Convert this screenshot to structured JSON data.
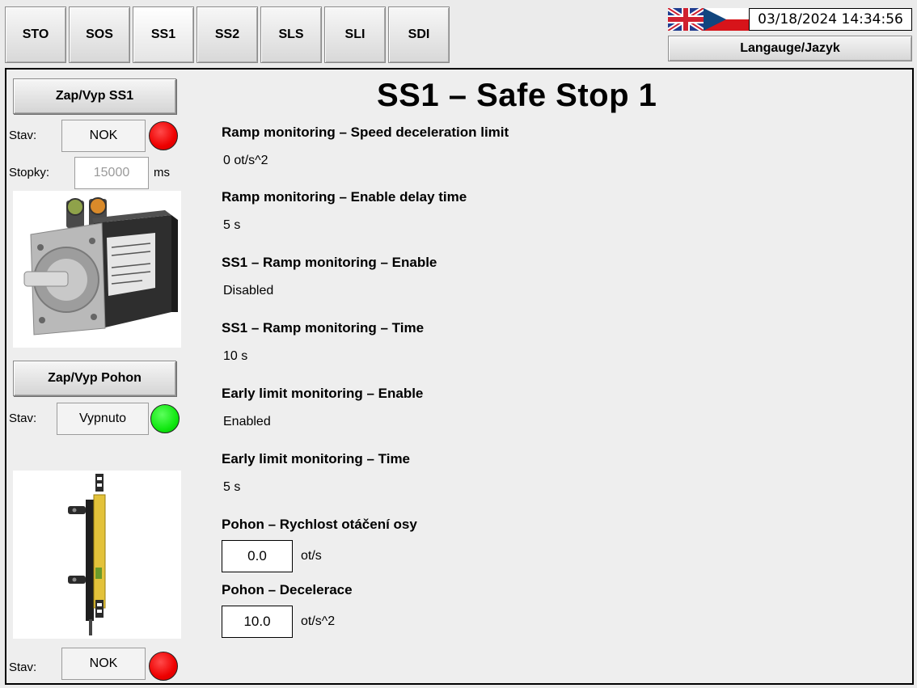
{
  "tabs": [
    {
      "label": "STO"
    },
    {
      "label": "SOS"
    },
    {
      "label": "SS1"
    },
    {
      "label": "SS2"
    },
    {
      "label": "SLS"
    },
    {
      "label": "SLI"
    },
    {
      "label": "SDI"
    }
  ],
  "active_tab": "SS1",
  "header": {
    "datetime": "03/18/2024 14:34:56",
    "language_button": "Langauge/Jazyk",
    "flags": [
      "uk-flag-icon",
      "czech-flag-icon"
    ]
  },
  "left_panel": {
    "ss1_toggle_label": "Zap/Vyp SS1",
    "ss1_state_label": "Stav:",
    "ss1_state_value": "NOK",
    "ss1_state_color": "#ff0000",
    "stopwatch_label": "Stopky:",
    "stopwatch_value": "15000",
    "stopwatch_unit": "ms",
    "drive_toggle_label": "Zap/Vyp Pohon",
    "drive_state_label": "Stav:",
    "drive_state_value": "Vypnuto",
    "drive_state_color": "#00ff00",
    "sensor_state_label": "Stav:",
    "sensor_state_value": "NOK",
    "sensor_state_color": "#ff0000"
  },
  "main": {
    "title": "SS1 – Safe Stop 1",
    "params": [
      {
        "label": "Ramp monitoring – Speed deceleration limit",
        "value": "0 ot/s^2"
      },
      {
        "label": "Ramp monitoring – Enable delay time",
        "value": "5 s"
      },
      {
        "label": "SS1 – Ramp monitoring – Enable",
        "value": "Disabled"
      },
      {
        "label": "SS1 – Ramp monitoring – Time",
        "value": "10 s"
      },
      {
        "label": "Early limit monitoring – Enable",
        "value": "Enabled"
      },
      {
        "label": "Early limit monitoring – Time",
        "value": "5 s"
      }
    ],
    "drive_speed": {
      "label": "Pohon – Rychlost otáčení osy",
      "value": "0.0",
      "unit": "ot/s"
    },
    "drive_decel": {
      "label": "Pohon – Decelerace",
      "value": "10.0",
      "unit": "ot/s^2"
    }
  },
  "colors": {
    "lamp_red": "#ff0000",
    "lamp_green": "#00ff00",
    "background": "#eeeeee"
  }
}
